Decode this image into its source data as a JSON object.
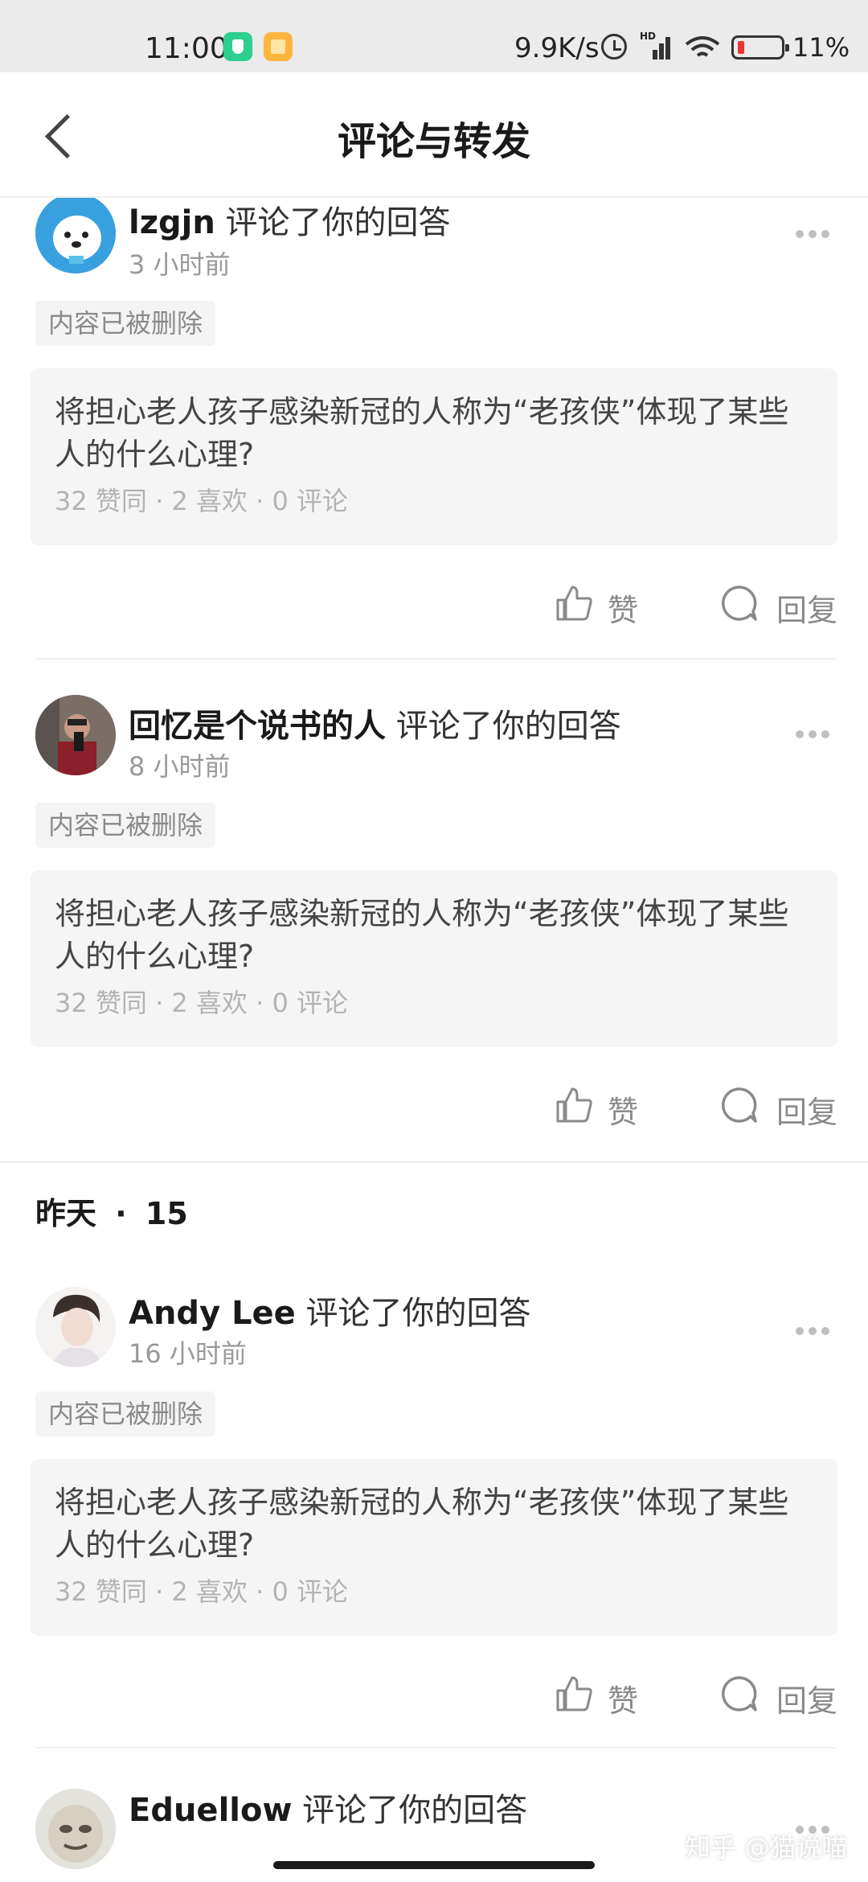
{
  "status_bar": {
    "time": "11:00",
    "net_speed": "9.9K/s",
    "network_badge": "HD",
    "battery": "11%"
  },
  "header": {
    "title": "评论与转发"
  },
  "notifications": [
    {
      "username": "lzgjn",
      "action": "评论了你的回答",
      "time": "3 小时前",
      "deleted_label": "内容已被删除",
      "question": "将担心老人孩子感染新冠的人称为“老孩侠”体现了某些人的什么心理?",
      "stats": "32 赞同  ·  2 喜欢  ·  0 评论",
      "like_label": "赞",
      "reply_label": "回复"
    },
    {
      "username": "回忆是个说书的人",
      "action": "评论了你的回答",
      "time": "8 小时前",
      "deleted_label": "内容已被删除",
      "question": "将担心老人孩子感染新冠的人称为“老孩侠”体现了某些人的什么心理?",
      "stats": "32 赞同  ·  2 喜欢  ·  0 评论",
      "like_label": "赞",
      "reply_label": "回复"
    },
    {
      "username": "Andy Lee",
      "action": "评论了你的回答",
      "time": "16 小时前",
      "deleted_label": "内容已被删除",
      "question": "将担心老人孩子感染新冠的人称为“老孩侠”体现了某些人的什么心理?",
      "stats": "32 赞同  ·  2 喜欢  ·  0 评论",
      "like_label": "赞",
      "reply_label": "回复"
    },
    {
      "username": "Eduellow",
      "action": "评论了你的回答"
    }
  ],
  "section": {
    "label": "昨天",
    "count": "15"
  },
  "watermark": "知乎 @猫说喵",
  "colors": {
    "accent_text": "#1a1a1a",
    "secondary_text": "#999999",
    "card_bg": "#f5f5f5",
    "status_bar_bg": "#ebebeb",
    "battery_low": "#e33333"
  },
  "icons": [
    "back-arrow-icon",
    "more-dots-icon",
    "thumb-up-icon",
    "comment-bubble-icon",
    "alarm-icon",
    "signal-icon",
    "wifi-icon",
    "battery-icon"
  ]
}
